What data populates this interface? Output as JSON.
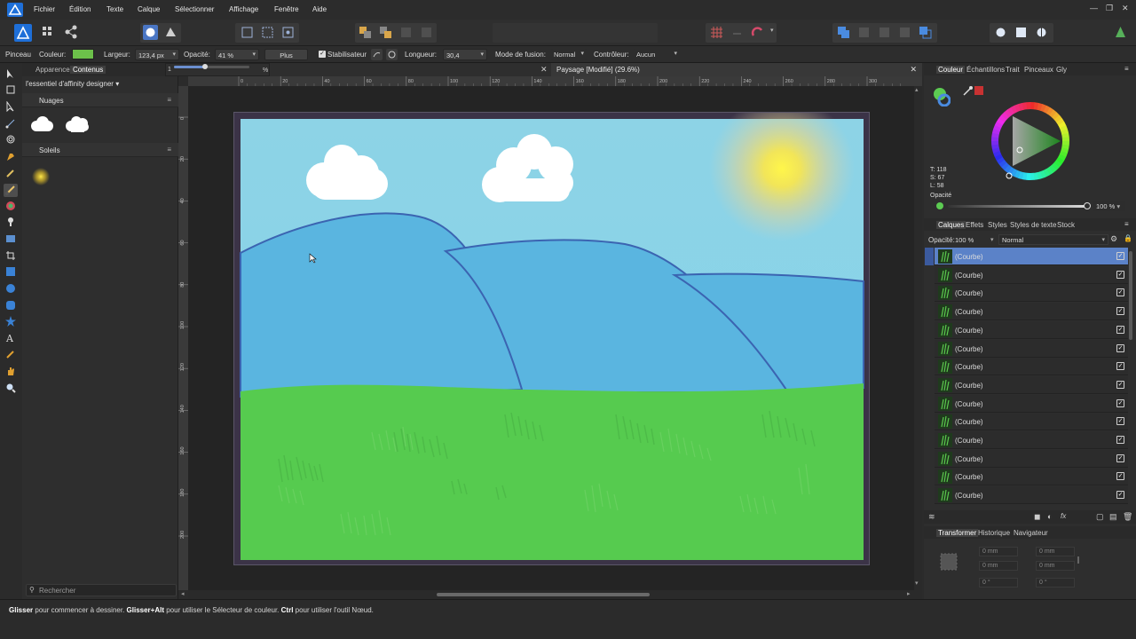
{
  "menu": [
    "Fichier",
    "Édition",
    "Texte",
    "Calque",
    "Sélectionner",
    "Affichage",
    "Fenêtre",
    "Aide"
  ],
  "window_controls": [
    "—",
    "❐",
    "✕"
  ],
  "context": {
    "tool": "Pinceau",
    "color_label": "Couleur:",
    "color": "#6cc04a",
    "width_label": "Largeur:",
    "width_value": "123,4 px",
    "opacity_label": "Opacité:",
    "opacity_value": "41 %",
    "more_button": "Plus",
    "stabilizer_label": "Stabilisateur",
    "length_label": "Longueur:",
    "length_value": "30,4",
    "blend_label": "Mode de fusion:",
    "blend_value": "Normal",
    "controller_label": "Contrôleur:",
    "controller_value": "Aucun",
    "opacity_popup_percent": "%",
    "opacity_popup_level": 0.41
  },
  "left_panel": {
    "tabs": [
      "Apparence",
      "Contenus"
    ],
    "category": "l'essentiel d'affinity designer",
    "sections": [
      {
        "title": "Nuages"
      },
      {
        "title": "Soleils"
      }
    ],
    "search_placeholder": "Rechercher"
  },
  "document": {
    "tab_title": "Paysage [Modifié] (29.6%)",
    "ruler_h": [
      "0",
      "20",
      "40",
      "60",
      "80",
      "100",
      "120",
      "140",
      "160",
      "180",
      "200",
      "220",
      "240",
      "260",
      "280",
      "300"
    ],
    "ruler_v": [
      "0",
      "20",
      "40",
      "60",
      "80",
      "100",
      "120",
      "140",
      "160",
      "180",
      "200"
    ]
  },
  "color_panel": {
    "tabs": [
      "Couleur",
      "Échantillons",
      "Trait",
      "Pinceaux",
      "Gly"
    ],
    "hsl": [
      "T: 118",
      "S: 67",
      "L: 58"
    ],
    "opacity_label": "Opacité",
    "opacity_value": "100 %",
    "accent": "#5ccb52"
  },
  "layers_panel": {
    "tabs": [
      "Calques",
      "Effets",
      "Styles",
      "Styles de texte",
      "Stock"
    ],
    "opacity_label": "Opacité:",
    "opacity_value": "100 %",
    "blend_value": "Normal",
    "layers": [
      {
        "name": "(Courbe)",
        "selected": true
      },
      {
        "name": "(Courbe)"
      },
      {
        "name": "(Courbe)"
      },
      {
        "name": "(Courbe)"
      },
      {
        "name": "(Courbe)"
      },
      {
        "name": "(Courbe)"
      },
      {
        "name": "(Courbe)"
      },
      {
        "name": "(Courbe)"
      },
      {
        "name": "(Courbe)"
      },
      {
        "name": "(Courbe)"
      },
      {
        "name": "(Courbe)"
      },
      {
        "name": "(Courbe)"
      },
      {
        "name": "(Courbe)"
      },
      {
        "name": "(Courbe)"
      }
    ]
  },
  "transform_panel": {
    "tabs": [
      "Transformer",
      "Historique",
      "Navigateur"
    ],
    "fields": [
      "0 mm",
      "0 mm",
      "0 mm",
      "0 mm",
      "0 °",
      "0 °"
    ]
  },
  "status": {
    "part1_bold": "Glisser",
    "part1": " pour commencer à dessiner. ",
    "part2_bold": "Glisser+Alt",
    "part2": " pour utiliser le Sélecteur de couleur. ",
    "part3_bold": "Ctrl",
    "part3": " pour utiliser l'outil Nœud."
  }
}
